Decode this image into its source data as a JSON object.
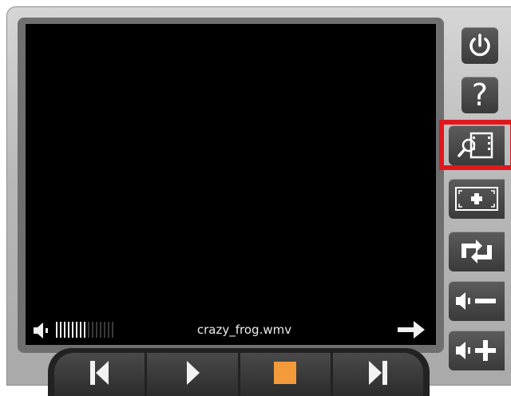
{
  "player": {
    "filename": "crazy_frog.wmv",
    "volume_fraction": 0.55,
    "volume_bars_total": 15
  },
  "sidebar": {
    "items": [
      {
        "name": "power",
        "icon": "power-icon"
      },
      {
        "name": "help",
        "icon": "question-icon",
        "glyph": "?"
      },
      {
        "name": "browse-video",
        "icon": "film-search-icon",
        "highlighted": true
      },
      {
        "name": "fullscreen",
        "icon": "fullscreen-icon"
      },
      {
        "name": "repeat",
        "icon": "repeat-icon"
      },
      {
        "name": "volume-down",
        "icon": "volume-down-icon"
      },
      {
        "name": "volume-up",
        "icon": "volume-up-icon"
      }
    ]
  },
  "transport": {
    "buttons": [
      {
        "name": "previous",
        "icon": "skip-back-icon"
      },
      {
        "name": "play",
        "icon": "play-icon"
      },
      {
        "name": "stop",
        "icon": "stop-icon"
      },
      {
        "name": "next",
        "icon": "skip-forward-icon"
      }
    ]
  },
  "colors": {
    "highlight": "#e3161b",
    "stop": "#f39a3b",
    "screen": "#000000"
  }
}
